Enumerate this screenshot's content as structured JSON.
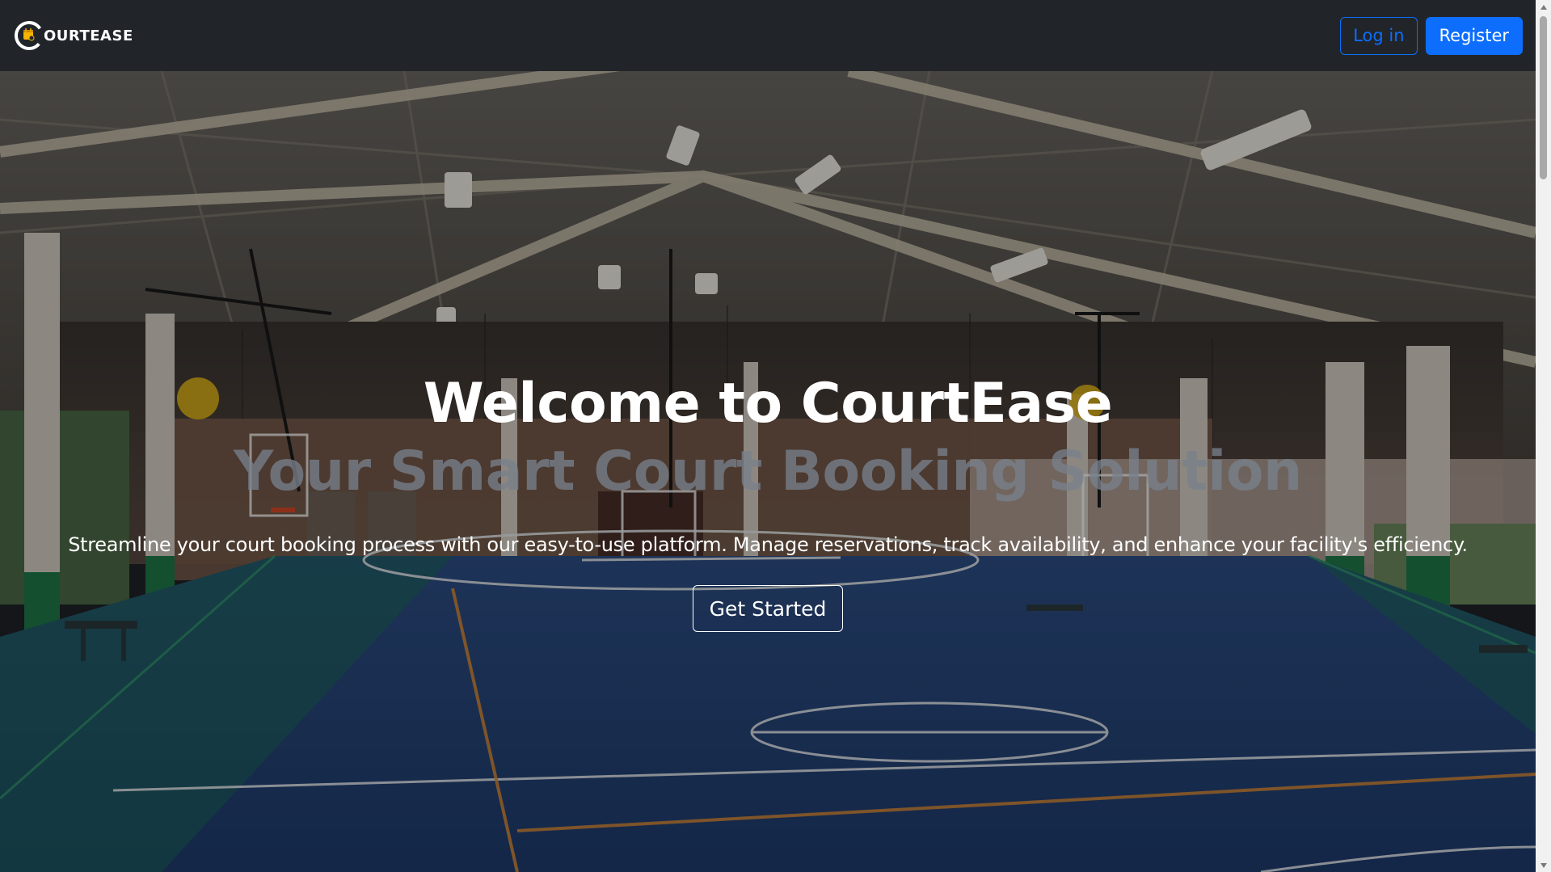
{
  "navbar": {
    "brand": "OURTEASE",
    "login_label": "Log in",
    "register_label": "Register"
  },
  "hero": {
    "title": "Welcome to CourtEase",
    "subtitle": "Your Smart Court Booking Solution",
    "description": "Streamline your court booking process with our easy-to-use platform. Manage reservations, track availability, and enhance your facility's efficiency.",
    "cta_label": "Get Started",
    "background_image": "indoor-basketball-court-photo"
  },
  "colors": {
    "navbar_bg": "#212529",
    "primary": "#0d6efd",
    "logo_accent": "#f5b400"
  },
  "scrollbar": {
    "position_fraction": 0.0
  }
}
